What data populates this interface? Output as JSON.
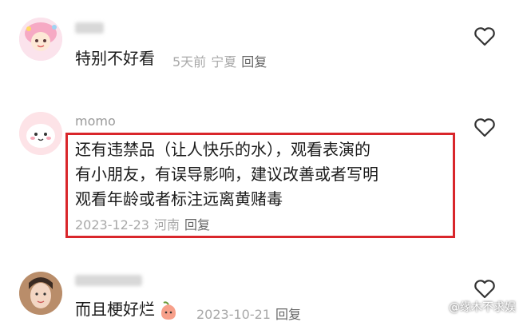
{
  "comments": [
    {
      "username": "",
      "text": "特别不好看",
      "time": "5天前",
      "location": "宁夏",
      "reply_label": "回复",
      "icon": "heart-outline-icon"
    },
    {
      "username": "momo",
      "text_lines": [
        "还有违禁品（让人快乐的水），观看表演的",
        "有小朋友，有误导影响，建议改善或者写明",
        "观看年龄或者标注远离黄赌毒"
      ],
      "time": "2023-12-23",
      "location": "河南",
      "reply_label": "回复",
      "icon": "heart-outline-icon"
    },
    {
      "username": "",
      "text": "而且梗好烂",
      "time": "2023-10-21",
      "reply_label": "回复",
      "icon": "heart-outline-icon"
    }
  ],
  "watermark": "@缘木不求娱",
  "colors": {
    "highlight_border": "#d9262b",
    "meta_text": "#a8a8a8"
  }
}
